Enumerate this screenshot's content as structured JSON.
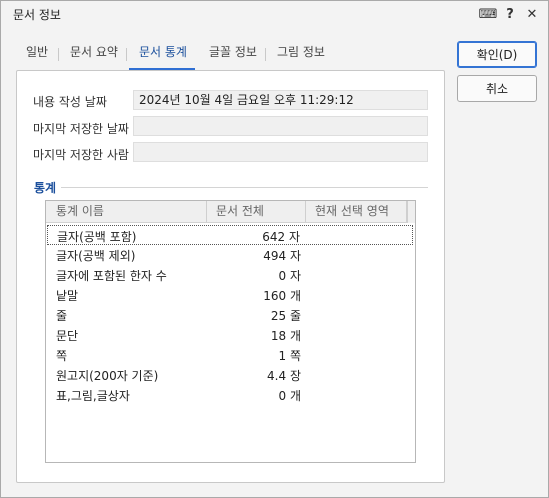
{
  "window": {
    "title": "문서 정보",
    "help_glyph": "?",
    "close_glyph": "✕",
    "keyboard_glyph": "⌨"
  },
  "tabs": [
    {
      "label": "일반",
      "active": false
    },
    {
      "label": "문서 요약",
      "active": false
    },
    {
      "label": "문서 통계",
      "active": true
    },
    {
      "label": "글꼴 정보",
      "active": false
    },
    {
      "label": "그림 정보",
      "active": false
    }
  ],
  "info": {
    "created_label": "내용 작성 날짜",
    "created_value": "2024년 10월 4일 금요일 오후 11:29:12",
    "saved_label": "마지막 저장한 날짜",
    "saved_value": "",
    "saver_label": "마지막 저장한 사람",
    "saver_value": ""
  },
  "stats": {
    "section_title": "통계",
    "columns": [
      "통계 이름",
      "문서 전체",
      "현재 선택 영역"
    ],
    "rows": [
      {
        "name": "글자(공백 포함)",
        "total": "642 자",
        "selected": true
      },
      {
        "name": "글자(공백 제외)",
        "total": "494 자",
        "selected": false
      },
      {
        "name": "글자에 포함된 한자 수",
        "total": "0 자",
        "selected": false
      },
      {
        "name": "낱말",
        "total": "160 개",
        "selected": false
      },
      {
        "name": "줄",
        "total": "25 줄",
        "selected": false
      },
      {
        "name": "문단",
        "total": "18 개",
        "selected": false
      },
      {
        "name": "쪽",
        "total": "1 쪽",
        "selected": false
      },
      {
        "name": "원고지(200자 기준)",
        "total": "4.4 장",
        "selected": false
      },
      {
        "name": "표,그림,글상자",
        "total": "0 개",
        "selected": false
      }
    ]
  },
  "buttons": {
    "ok_label": "확인(D)",
    "cancel_label": "취소"
  },
  "colors": {
    "accent": "#2f6fd3",
    "active_tab_text": "#1b4f9c"
  }
}
